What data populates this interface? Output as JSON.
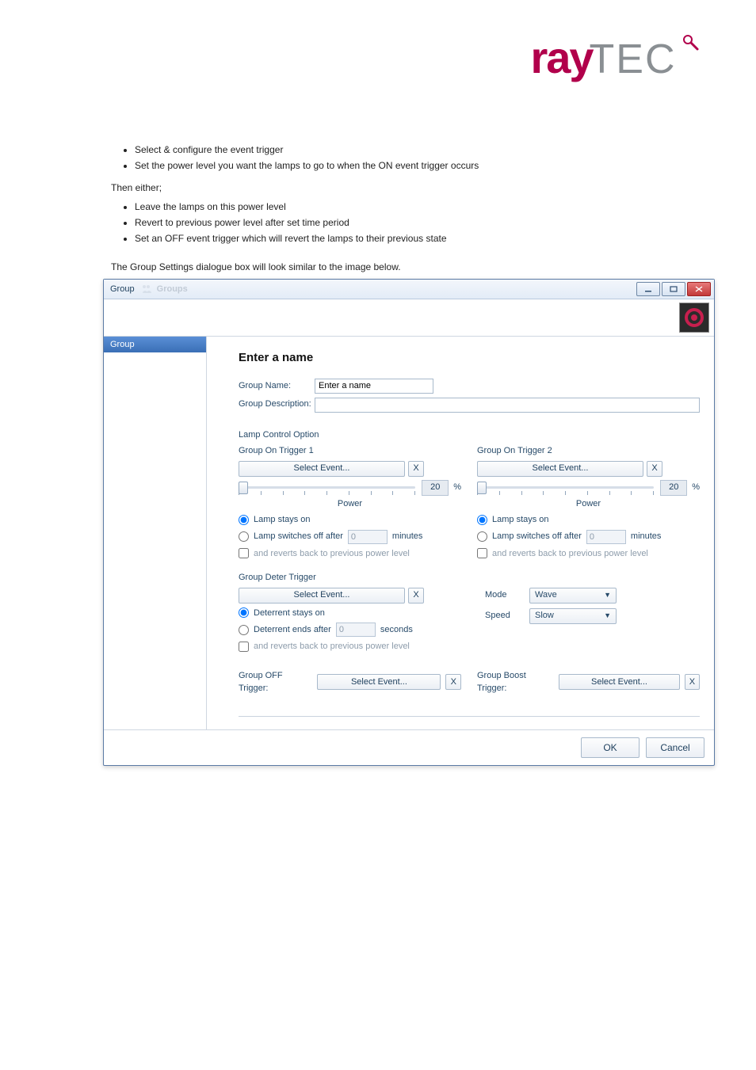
{
  "logo": {
    "ray": "ray",
    "tec": "TEC"
  },
  "bullets_a": [
    "Select & configure the event trigger",
    "Set the power level you want the lamps to go to when the ON event trigger occurs"
  ],
  "para_a": "Then either;",
  "bullets_b": [
    "Leave the lamps on this power level",
    "Revert to previous power level after set time period",
    "Set an OFF event trigger which will revert the lamps to their previous state"
  ],
  "caption": "The Group Settings dialogue box will look similar to the image below.",
  "window": {
    "title": "Group",
    "faded_title": "Groups",
    "sidebar_header": "Group",
    "section_title": "Enter a name",
    "group_name_label": "Group Name:",
    "group_name_value": "Enter a name",
    "group_desc_label": "Group Description:",
    "group_desc_value": "",
    "lamp_control_label": "Lamp Control Option",
    "trigger1_label": "Group On Trigger 1",
    "trigger2_label": "Group On Trigger 2",
    "select_event": "Select Event...",
    "clear_x": "X",
    "power_value": "20",
    "power_unit": "%",
    "power_axis": "Power",
    "lamp_stays_on": "Lamp stays on",
    "lamp_off_after": "Lamp switches off after",
    "minutes_value": "0",
    "minutes_unit": "minutes",
    "revert_prev": "and reverts back to previous power level",
    "group_deter_label": "Group Deter Trigger",
    "deter_stays_on": "Deterrent stays on",
    "deter_ends_after": "Deterrent ends after",
    "seconds_value": "0",
    "seconds_unit": "seconds",
    "mode_label": "Mode",
    "mode_selected": "Wave",
    "speed_label": "Speed",
    "speed_selected": "Slow",
    "group_off_label": "Group OFF Trigger:",
    "group_boost_label": "Group Boost Trigger:",
    "ok": "OK",
    "cancel": "Cancel"
  }
}
